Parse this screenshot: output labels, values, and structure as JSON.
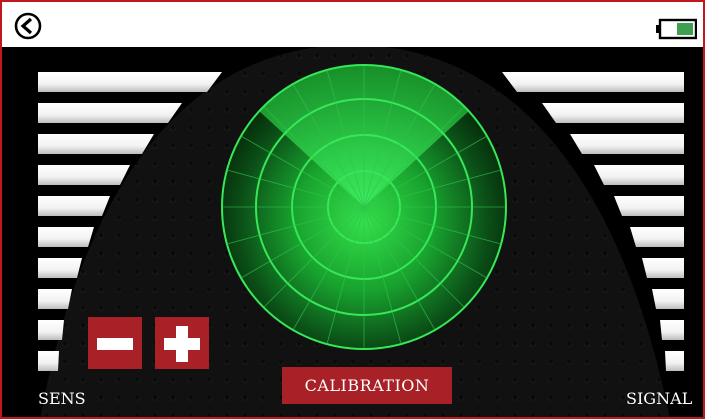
{
  "topbar": {
    "back_icon": "back-arrow-circle-icon",
    "battery_icon": "battery-icon",
    "battery_level": 0.5,
    "battery_color": "#3ca050"
  },
  "labels": {
    "sens": "SENS",
    "signal": "SIGNAL",
    "calibration": "CALIBRATION"
  },
  "sensitivity": {
    "minus_icon": "minus-icon",
    "plus_icon": "plus-icon",
    "bars_total": 10
  },
  "signal_meter": {
    "bars_total": 10
  },
  "radar": {
    "rings": 4,
    "sweep_color": "#27e04a"
  },
  "colors": {
    "accent": "#a82126",
    "frame": "#c0181c",
    "background": "#000000",
    "radar_green": "#1fdc3a"
  }
}
